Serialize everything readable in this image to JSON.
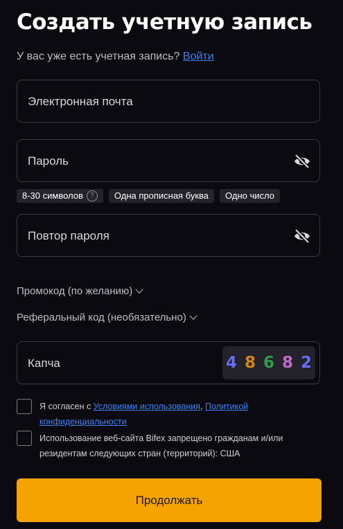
{
  "header": {
    "title": "Создать учетную запись",
    "have_account_text": "У вас уже есть учетная запись? ",
    "login_link": "Войти"
  },
  "form": {
    "email": {
      "placeholder": "Электронная почта",
      "value": ""
    },
    "password": {
      "placeholder": "Пароль",
      "value": ""
    },
    "password_rules": [
      "8-30 символов",
      "Одна прописная буква",
      "Одно число"
    ],
    "password_help_glyph": "?",
    "repeat_password": {
      "placeholder": "Повтор пароля",
      "value": ""
    },
    "promo_label": "Промокод (по желанию)",
    "referral_label": "Реферальный код (необязательно)",
    "captcha": {
      "placeholder": "Капча",
      "value": "",
      "digits": [
        {
          "char": "4",
          "color": "#6a6cf2"
        },
        {
          "char": "8",
          "color": "#d08a14"
        },
        {
          "char": "6",
          "color": "#2f9c48"
        },
        {
          "char": "8",
          "color": "#c06bc8"
        },
        {
          "char": "2",
          "color": "#6a6cf2"
        }
      ]
    },
    "terms": {
      "prefix": "Я согласен с ",
      "terms_link": "Условиями использования",
      "separator": ", ",
      "privacy_link_part1": "Политикой",
      "privacy_link_part2": "конфиденциальности"
    },
    "restriction": {
      "line1": "Использование веб-сайта Bifex запрещено гражданам и/или",
      "line2": "резидентам следующих стран (территорий): США"
    },
    "submit_label": "Продолжать"
  },
  "colors": {
    "background": "#0b0a10",
    "accent": "#f5a300",
    "link": "#3b82f6"
  }
}
